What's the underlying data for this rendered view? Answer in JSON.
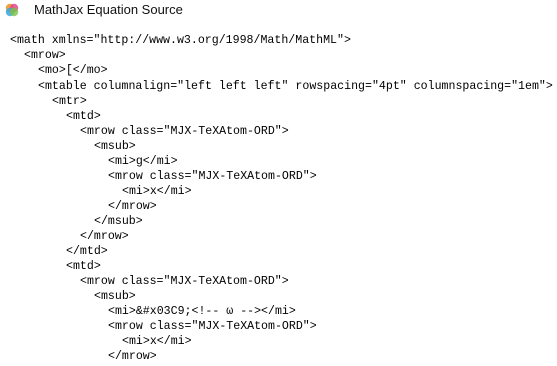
{
  "window": {
    "title": "MathJax Equation Source",
    "icon": "mathjax-logo-icon"
  },
  "source": {
    "lines": [
      "<math xmlns=\"http://www.w3.org/1998/Math/MathML\">",
      "<mrow>",
      "<mo>[</mo>",
      "<mtable columnalign=\"left left left\" rowspacing=\"4pt\" columnspacing=\"1em\">",
      "<mtr>",
      "<mtd>",
      "<mrow class=\"MJX-TeXAtom-ORD\">",
      "<msub>",
      "<mi>g</mi>",
      "<mrow class=\"MJX-TeXAtom-ORD\">",
      "<mi>x</mi>",
      "</mrow>",
      "</msub>",
      "</mrow>",
      "</mtd>",
      "<mtd>",
      "<mrow class=\"MJX-TeXAtom-ORD\">",
      "<msub>",
      "<mi>&#x03C9;<!-- ω --></mi>",
      "<mrow class=\"MJX-TeXAtom-ORD\">",
      "<mi>x</mi>",
      "</mrow>"
    ]
  }
}
